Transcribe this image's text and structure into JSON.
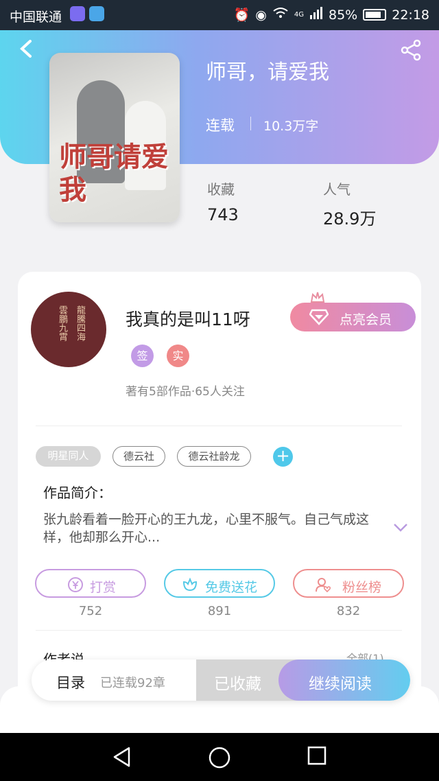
{
  "status_bar": {
    "carrier": "中国联通",
    "network": "4G",
    "battery": "85%",
    "time": "22:18"
  },
  "book": {
    "title": "师哥，请爱我",
    "cover_title": "师哥请爱我",
    "status": "连载",
    "word_count": "10.3万字",
    "favorites_label": "收藏",
    "favorites_value": "743",
    "popularity_label": "人气",
    "popularity_value": "28.9万"
  },
  "author": {
    "name": "我真的是叫11呀",
    "vip_button": "点亮会员",
    "badges": [
      "签",
      "实"
    ],
    "stats": "著有5部作品·65人关注",
    "avatar_text": [
      "龍騰四海",
      "雲鵬九霄"
    ]
  },
  "tags": [
    "明星同人",
    "德云社",
    "德云社龄龙"
  ],
  "intro": {
    "heading": "作品简介：",
    "text": "张九龄看着一脸开心的王九龙，心里不服气。自己气成这样，他却那么开心..."
  },
  "actions": [
    {
      "label": "打赏",
      "count": "752",
      "color": "#c79be0"
    },
    {
      "label": "免费送花",
      "count": "891",
      "color": "#55c9e6"
    },
    {
      "label": "粉丝榜",
      "count": "832",
      "color": "#ee8e8e"
    }
  ],
  "authors_say": {
    "heading": "作者说",
    "all_link": "全部(1)"
  },
  "bottom_bar": {
    "toc": "目录",
    "chapters": "已连载92章",
    "favorited": "已收藏",
    "continue": "继续阅读"
  },
  "colors": {
    "hero_start": "#5dd5ee",
    "hero_end": "#c39be6",
    "vip_start": "#f08aa1",
    "vip_end": "#c88ed8"
  }
}
